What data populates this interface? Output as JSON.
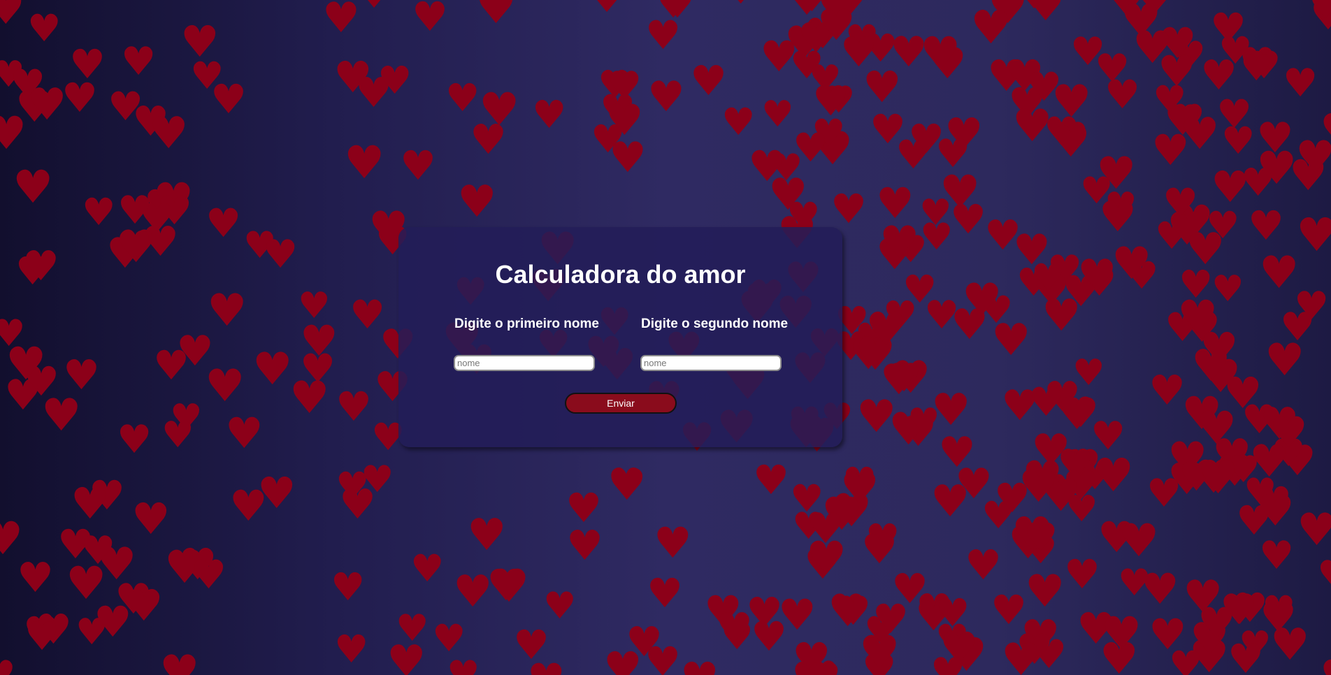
{
  "page": {
    "title": "Calculadora do amor"
  },
  "form": {
    "first_name_label": "Digite o primeiro nome",
    "first_name_placeholder": "nome",
    "first_name_value": "",
    "second_name_label": "Digite o segundo nome",
    "second_name_placeholder": "nome",
    "second_name_value": "",
    "submit_label": "Enviar"
  },
  "background": {
    "decoration_icon": "heart-icon",
    "heart_color": "#8c0019",
    "gradient_colors": [
      "#120f2e",
      "#2f2a62",
      "#1d1a43"
    ]
  },
  "colors": {
    "card_background": "#221d58",
    "button_background": "#8a0c1c",
    "text": "#ffffff"
  }
}
